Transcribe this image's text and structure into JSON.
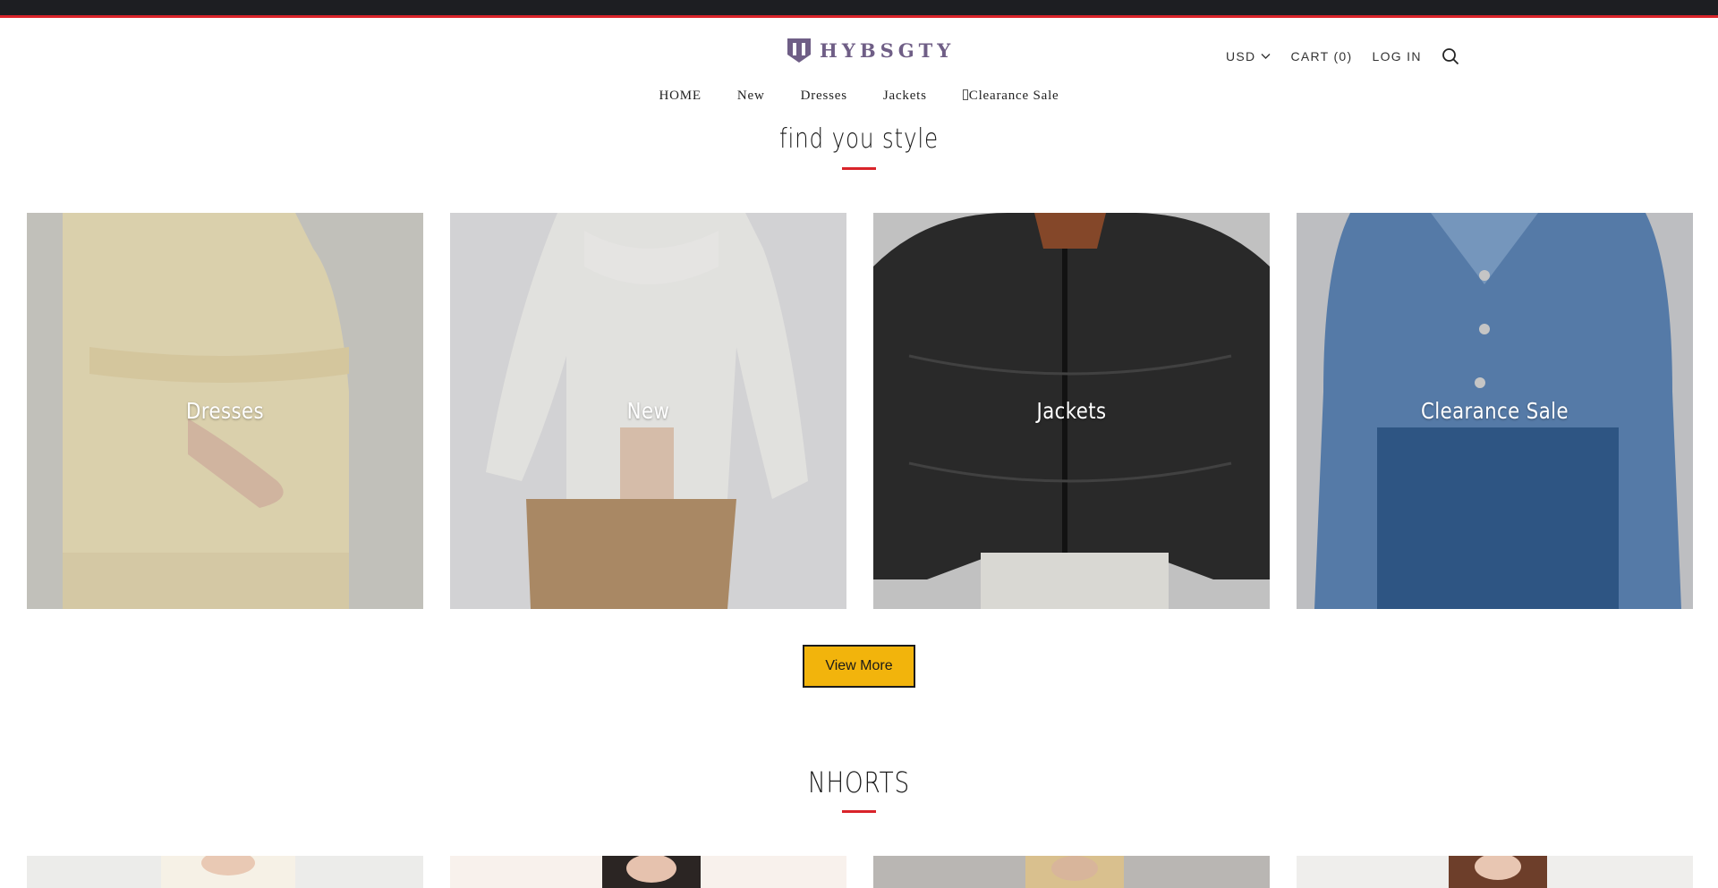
{
  "header": {
    "logo_text": "HYBSGTY",
    "currency": "USD",
    "cart_label": "CART (0)",
    "login_label": "LOG IN"
  },
  "nav": [
    {
      "label": "HOME"
    },
    {
      "label": "New"
    },
    {
      "label": "Dresses"
    },
    {
      "label": "Jackets"
    },
    {
      "label": "Clearance Sale"
    }
  ],
  "collections_section": {
    "title": "find you style",
    "tiles": [
      {
        "label": "Dresses"
      },
      {
        "label": "New"
      },
      {
        "label": "Jackets"
      },
      {
        "label": "Clearance Sale"
      }
    ],
    "view_more_label": "View More"
  },
  "products_section": {
    "title": "NHORTS"
  },
  "colors": {
    "topbar": "#1d1e22",
    "accent_red": "#d9232a",
    "button_yellow": "#f2b40c",
    "logo_purple": "#6f5e86"
  },
  "icons": [
    "logo-mark",
    "chevron-down-icon",
    "search-icon",
    "nav-clearance-icon"
  ]
}
